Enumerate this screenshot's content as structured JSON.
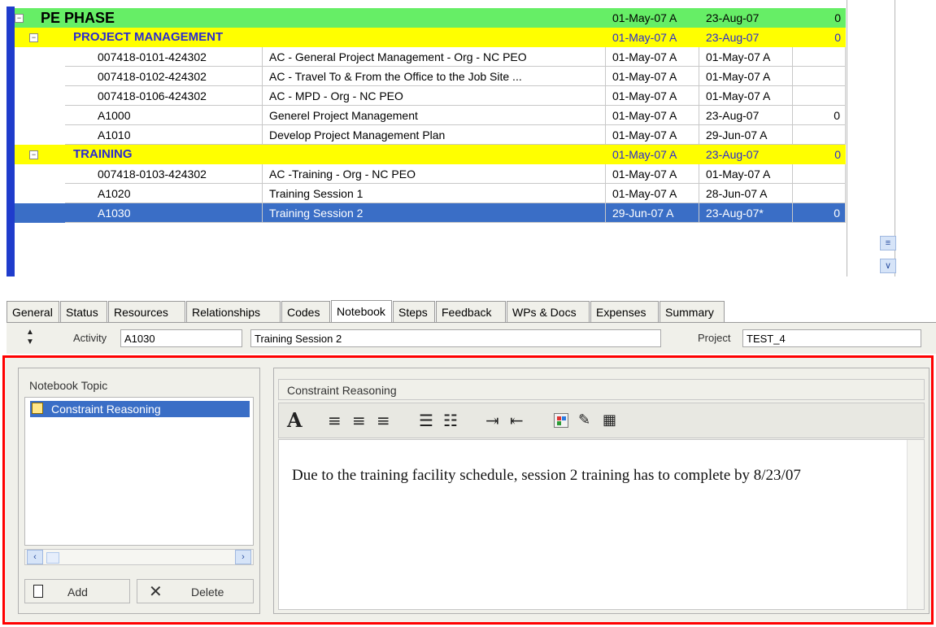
{
  "activity_table": {
    "rows": [
      {
        "type": "wbs1",
        "expander": "−",
        "id": "PE PHASE",
        "name": "",
        "start": "01-May-07 A",
        "finish": "23-Aug-07",
        "value": "0"
      },
      {
        "type": "wbs2",
        "expander": "−",
        "id": "PROJECT MANAGEMENT",
        "name": "",
        "start": "01-May-07 A",
        "finish": "23-Aug-07",
        "value": "0"
      },
      {
        "type": "act",
        "id": "007418-0101-424302",
        "name": "AC - General Project Management - Org - NC PEO",
        "start": "01-May-07 A",
        "finish": "01-May-07 A",
        "value": ""
      },
      {
        "type": "act",
        "id": "007418-0102-424302",
        "name": "AC - Travel To & From the Office to the Job Site ...",
        "start": "01-May-07 A",
        "finish": "01-May-07 A",
        "value": ""
      },
      {
        "type": "act",
        "id": "007418-0106-424302",
        "name": "AC - MPD - Org - NC PEO",
        "start": "01-May-07 A",
        "finish": "01-May-07 A",
        "value": ""
      },
      {
        "type": "act",
        "id": "A1000",
        "name": "Generel Project Management",
        "start": "01-May-07 A",
        "finish": "23-Aug-07",
        "value": "0"
      },
      {
        "type": "act",
        "id": "A1010",
        "name": "Develop Project Management Plan",
        "start": "01-May-07 A",
        "finish": "29-Jun-07 A",
        "value": ""
      },
      {
        "type": "wbs2",
        "expander": "−",
        "id": "TRAINING",
        "name": "",
        "start": "01-May-07 A",
        "finish": "23-Aug-07",
        "value": "0"
      },
      {
        "type": "act",
        "id": "007418-0103-424302",
        "name": "AC -Training - Org - NC PEO",
        "start": "01-May-07 A",
        "finish": "01-May-07 A",
        "value": ""
      },
      {
        "type": "act",
        "id": "A1020",
        "name": "Training Session 1",
        "start": "01-May-07 A",
        "finish": "28-Jun-07 A",
        "value": ""
      },
      {
        "type": "sel",
        "id": "A1030",
        "name": "Training Session 2",
        "start": "29-Jun-07 A",
        "finish": "23-Aug-07*",
        "value": "0"
      }
    ]
  },
  "tabs": [
    "General",
    "Status",
    "Resources",
    "Relationships",
    "Codes",
    "Notebook",
    "Steps",
    "Feedback",
    "WPs & Docs",
    "Expenses",
    "Summary"
  ],
  "active_tab": "Notebook",
  "activity_bar": {
    "activity_label": "Activity",
    "activity_id": "A1030",
    "activity_name": "Training Session 2",
    "project_label": "Project",
    "project_id": "TEST_4"
  },
  "notebook": {
    "topic_header": "Notebook Topic",
    "topics": [
      "Constraint Reasoning"
    ],
    "add_label": "Add",
    "delete_label": "Delete",
    "content_header": "Constraint Reasoning",
    "text": "Due to the training facility schedule, session 2 training has to complete by 8/23/07"
  }
}
